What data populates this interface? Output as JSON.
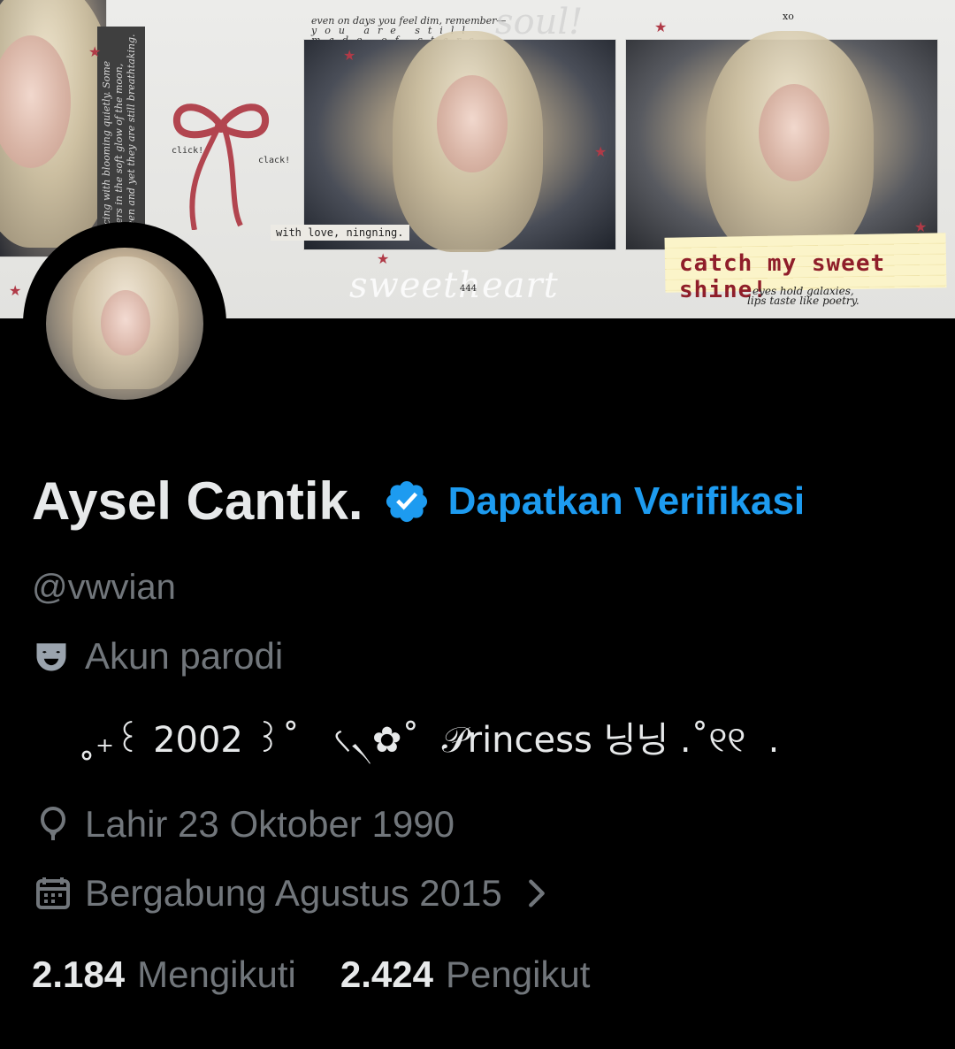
{
  "banner": {
    "quote_line1": "even on days you feel dim, remember—",
    "quote_line2": "you are still made of stars.",
    "side_text": "noticing with blooming quietly. Some flowers in the soft glow of the moon, unseen and yet they are still breathtaking.",
    "xo": "xo",
    "click": "click!",
    "clack": "clack!",
    "with_love": "with love, ningning.",
    "sweetheart": "sweetheart",
    "number": "444",
    "soul": "soul!",
    "catch": "catch my sweet shine!",
    "eyes_line1": "eyes hold galaxies,",
    "eyes_line2": "lips taste like poetry."
  },
  "profile": {
    "display_name": "Aysel Cantik.",
    "verify_cta": "Dapatkan Verifikasi",
    "handle": "@vwvian",
    "parody_label": "Akun parodi",
    "bio": "˳₊꒰ 2002 ꒱˚   ৻৲✿˚  𝒫rincess 닝닝 .˚୧୧  .",
    "birth": "Lahir 23 Oktober 1990",
    "joined": "Bergabung Agustus 2015",
    "following_count": "2.184",
    "following_label": "Mengikuti",
    "followers_count": "2.424",
    "followers_label": "Pengikut"
  },
  "icons": {
    "verified": "verified-badge-icon",
    "parody": "theater-mask-icon",
    "birth": "balloon-icon",
    "joined": "calendar-icon",
    "chevron": "chevron-right-icon"
  },
  "colors": {
    "background": "#000000",
    "text_primary": "#e7e9ea",
    "text_secondary": "#71767b",
    "accent": "#1d9bf0"
  }
}
